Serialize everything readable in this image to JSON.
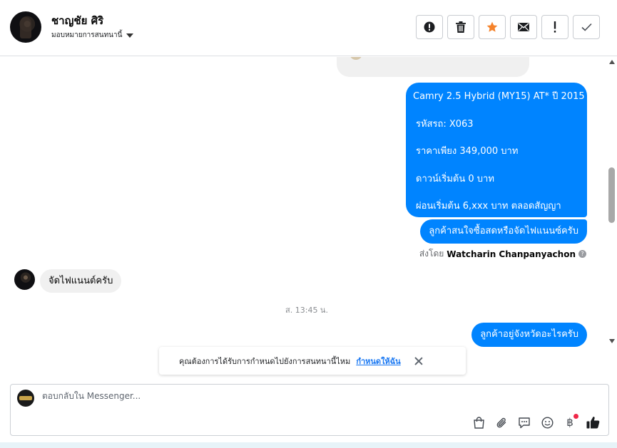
{
  "header": {
    "contact_name": "ชาญชัย ศิริ",
    "assign_label": "มอบหมายการสนทนานี้",
    "actions": [
      {
        "name": "mark-spam",
        "icon": "alert-circle-icon"
      },
      {
        "name": "delete",
        "icon": "trash-icon"
      },
      {
        "name": "star",
        "icon": "star-icon",
        "color": "#f5822a"
      },
      {
        "name": "mark-unread",
        "icon": "envelope-icon"
      },
      {
        "name": "follow-up",
        "icon": "exclamation-icon"
      },
      {
        "name": "mark-done",
        "icon": "check-icon"
      }
    ]
  },
  "thread": {
    "outgoing_detail": [
      "Camry 2.5 Hybrid (MY15) AT* ปี 2015",
      "รหัสรถ: X063",
      "ราคาเพียง 349,000 บาท",
      "ดาวน์เริ่มต้น 0 บาท",
      "ผ่อนเริ่มต้น 6,xxx บาท ตลอดสัญญา"
    ],
    "outgoing_question": "ลูกค้าสนใจซื้อสดหรือจัดไฟแนนซ์ครับ",
    "sent_by_prefix": "ส่งโดย",
    "sent_by_name": "Watcharin Chanpanyachon",
    "incoming_reply": "จัดไฟแนนต์ครับ",
    "timestamp": "ส. 13:45 น.",
    "outgoing_province": "ลูกค้าอยู่จังหวัดอะไรครับ"
  },
  "toast": {
    "text": "คุณต้องการได้รับการกำหนดไปยังการสนทนานี้ไหม",
    "link": "กำหนดให้ฉัน"
  },
  "composer": {
    "placeholder": "ตอบกลับใน Messenger...",
    "baht_symbol": "฿",
    "tools": [
      "shopping-bag-icon",
      "paperclip-icon",
      "saved-reply-icon",
      "emoji-icon",
      "baht-icon",
      "thumbs-up-icon"
    ]
  },
  "colors": {
    "accent": "#0084ff",
    "link": "#1877f2",
    "star": "#f5822a",
    "notification": "#f02849"
  }
}
